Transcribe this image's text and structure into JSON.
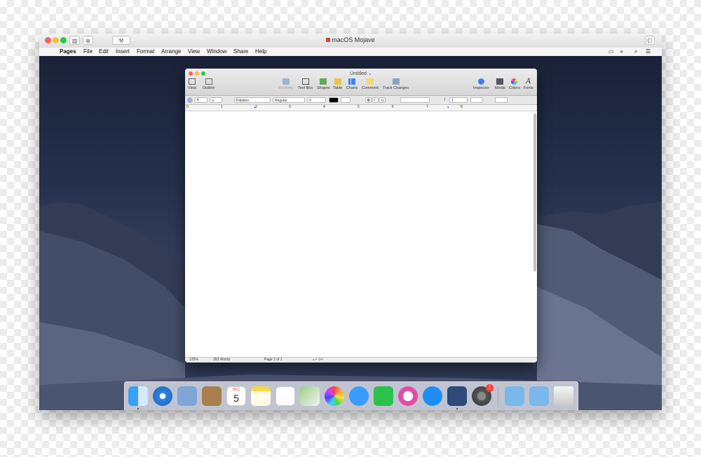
{
  "vm": {
    "title": "macOS Mojave",
    "buttons": [
      "sidebar-icon",
      "snapshots-icon",
      "settings-icon"
    ]
  },
  "menubar": {
    "apple": "",
    "app": "Pages",
    "items": [
      "File",
      "Edit",
      "Insert",
      "Format",
      "Arrange",
      "View",
      "Window",
      "Share",
      "Help"
    ]
  },
  "pages": {
    "title": "Untitled",
    "toolbar": {
      "view": "View",
      "outline": "Outline",
      "sections": "Sections",
      "textbox": "Text Box",
      "shapes": "Shapes",
      "table": "Table",
      "charts": "Charts",
      "comment": "Comment",
      "track_changes": "Track Changes",
      "inspector": "Inspector",
      "media": "Media",
      "colors": "Colors",
      "fonts": "Fonts",
      "fonts_glyph": "A"
    },
    "format": {
      "paragraph_style": "¶",
      "list": "a",
      "font": "Palatino",
      "typeface": "Regular",
      "size": "9",
      "bold": "B",
      "italic": "I",
      "underline": "U",
      "line_spacing": "1"
    },
    "ruler": [
      "0",
      "1",
      "2",
      "3",
      "4",
      "5",
      "6",
      "7",
      "8"
    ],
    "status": {
      "zoom": "125%",
      "words": "263 Words",
      "page": "Page 1 of 1"
    }
  },
  "dock": {
    "apps": [
      "finder-icon",
      "safari-icon",
      "preview-icon",
      "contacts-icon",
      "calendar-icon",
      "notes-icon",
      "reminders-icon",
      "maps-icon",
      "photos-icon",
      "messages-icon",
      "facetime-icon",
      "itunes-icon",
      "app-store-icon",
      "pages-icon",
      "system-preferences-icon",
      "applications-folder-icon",
      "downloads-folder-icon",
      "trash-icon"
    ],
    "calendar_day": "5",
    "calendar_month": "DEC",
    "badge": "1"
  },
  "colors": {
    "close": "#fe5f57",
    "minimize": "#febc2e",
    "zoom": "#28c840",
    "accent": "#3b82f6",
    "desktop": "#25304c"
  }
}
